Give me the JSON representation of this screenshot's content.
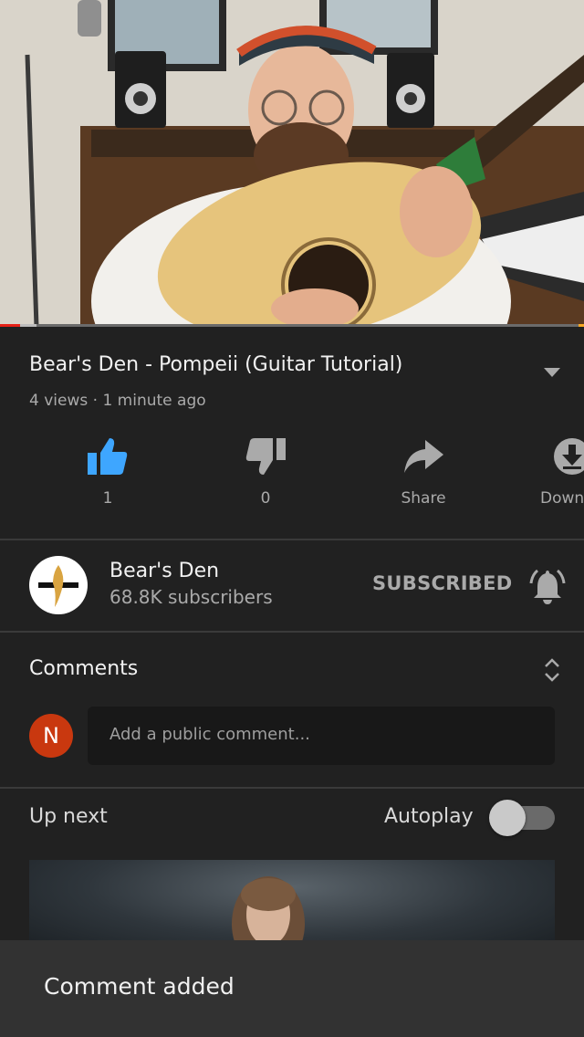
{
  "video": {
    "title": "Bear's Den - Pompeii (Guitar Tutorial)",
    "views": "4 views",
    "separator": " · ",
    "age": "1 minute ago",
    "progress_fraction": 0.035
  },
  "actions": {
    "like": {
      "label": "1",
      "active": true
    },
    "dislike": {
      "label": "0"
    },
    "share": {
      "label": "Share"
    },
    "download": {
      "label": "Down"
    }
  },
  "channel": {
    "name": "Bear's Den",
    "subscribers": "68.8K subscribers",
    "subscribe_state": "SUBSCRIBED"
  },
  "comments": {
    "title": "Comments",
    "user_initial": "N",
    "placeholder": "Add a public comment..."
  },
  "up_next": {
    "title": "Up next",
    "autoplay_label": "Autoplay",
    "autoplay_on": false
  },
  "snackbar": {
    "message": "Comment added"
  },
  "colors": {
    "background": "#212121",
    "like_active": "#3ea6ff",
    "progress": "#e62117",
    "user_avatar": "#c9380f",
    "snackbar": "#323232"
  }
}
